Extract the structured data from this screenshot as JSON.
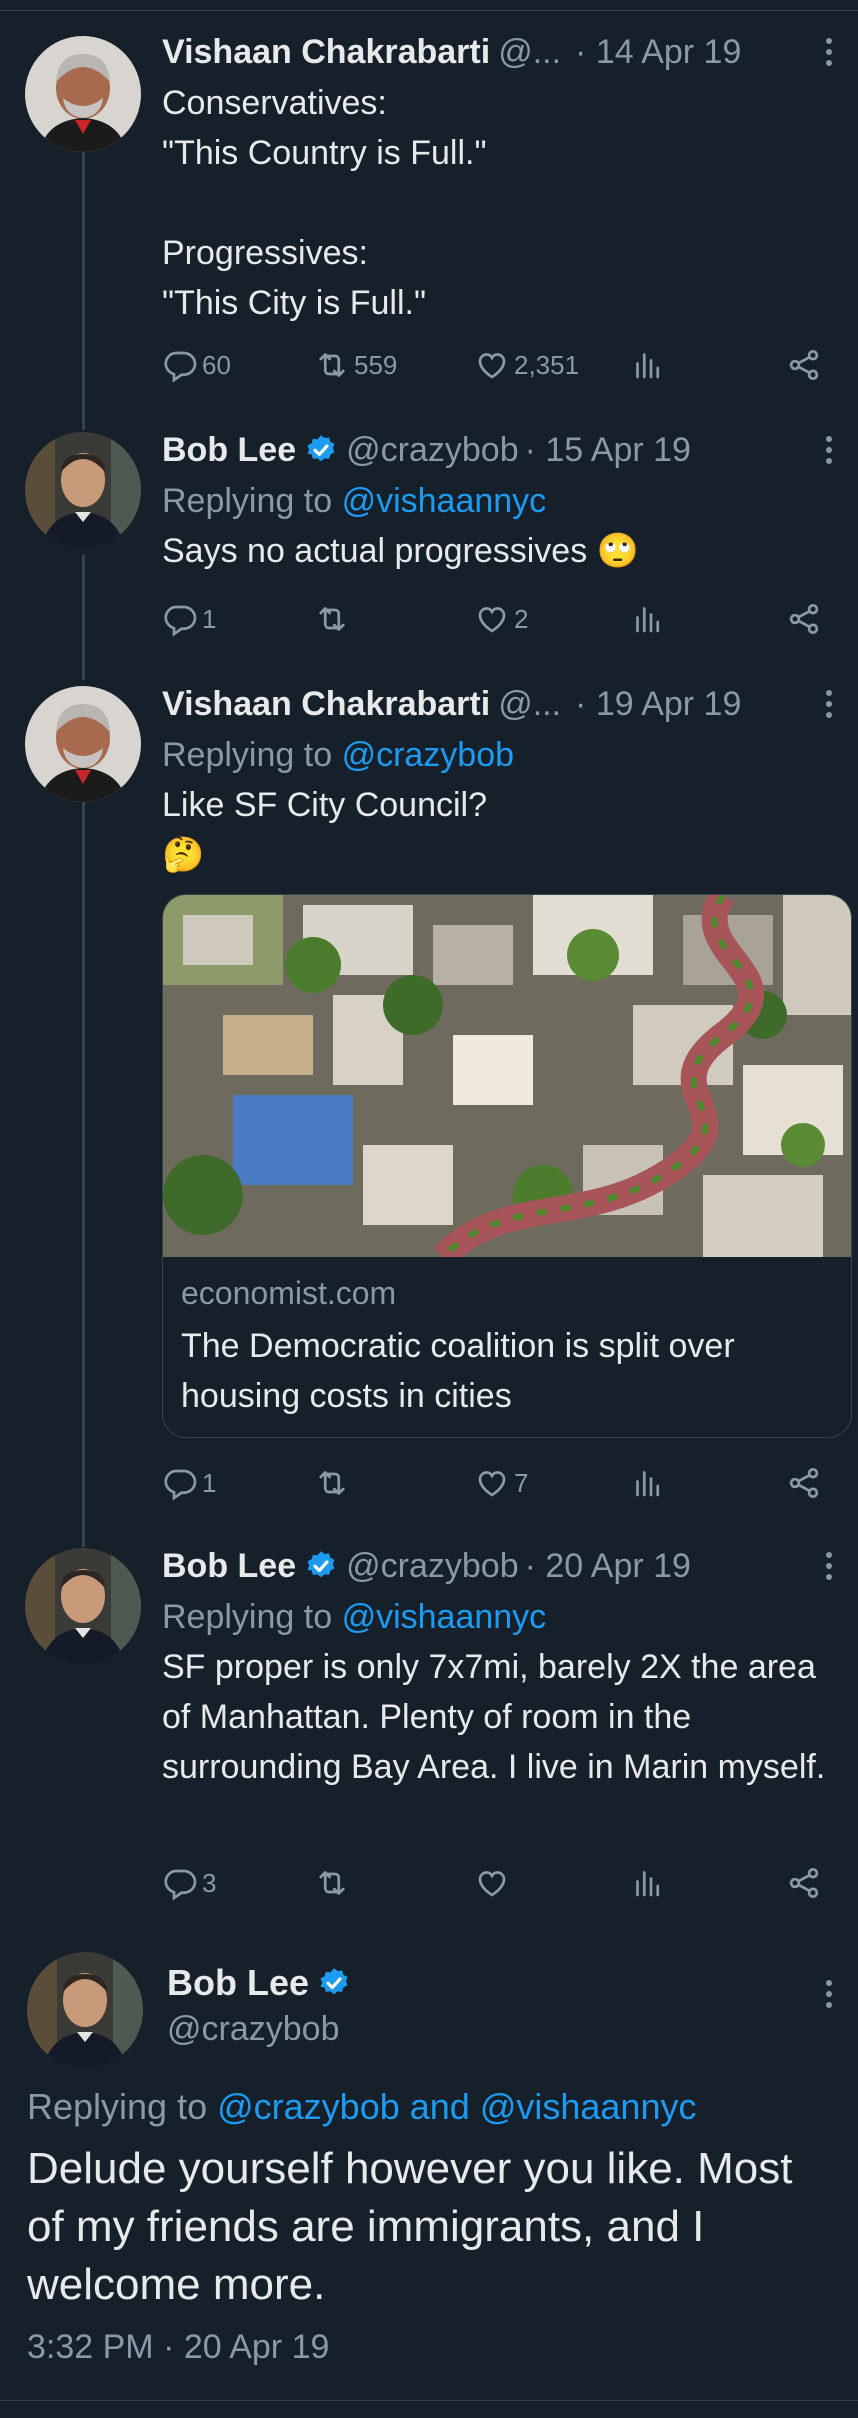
{
  "colors": {
    "background": "#15202b",
    "text": "#e7e9ea",
    "muted": "#8b98a5",
    "link": "#1d9bf0",
    "divider": "#38444d"
  },
  "tweets": [
    {
      "name": "Vishaan Chakrabarti",
      "handle": "@...",
      "date": "· 14 Apr 19",
      "verified": false,
      "replying_prefix": "",
      "replying_to": "",
      "text": "Conservatives:\n\"This Country is Full.\"\n\nProgressives:\n\"This City is Full.\"",
      "replies": "60",
      "retweets": "559",
      "likes": "2,351"
    },
    {
      "name": "Bob Lee",
      "handle": "@crazybob",
      "date": "· 15 Apr 19",
      "verified": true,
      "replying_prefix": "Replying to",
      "replying_to": "@vishaannyc",
      "text": "Says no actual progressives 🙄",
      "replies": "1",
      "retweets": "",
      "likes": "2"
    },
    {
      "name": "Vishaan Chakrabarti",
      "handle": "@...",
      "date": "· 19 Apr 19",
      "verified": false,
      "replying_prefix": "Replying to",
      "replying_to": "@crazybob",
      "text": "Like SF City Council?\n🤔",
      "card": {
        "domain": "economist.com",
        "title": "The Democratic coalition is split over housing costs in cities"
      },
      "replies": "1",
      "retweets": "",
      "likes": "7"
    },
    {
      "name": "Bob Lee",
      "handle": "@crazybob",
      "date": "· 20 Apr 19",
      "verified": true,
      "replying_prefix": "Replying to",
      "replying_to": "@vishaannyc",
      "text": "SF proper is only 7x7mi, barely 2X the area of Manhattan. Plenty of room in the surrounding Bay Area. I live in Marin myself.",
      "replies": "3",
      "retweets": "",
      "likes": ""
    }
  ],
  "main_tweet": {
    "name": "Bob Lee",
    "handle": "@crazybob",
    "replying_prefix": "Replying to",
    "replying_to": "@crazybob and @vishaannyc",
    "text": "Delude yourself however you like. Most of my friends are immigrants, and I welcome more.",
    "timestamp": "3:32 PM · 20 Apr 19"
  },
  "icons": [
    "reply-icon",
    "retweet-icon",
    "like-icon",
    "views-icon",
    "share-icon",
    "more-icon",
    "verified-icon"
  ]
}
